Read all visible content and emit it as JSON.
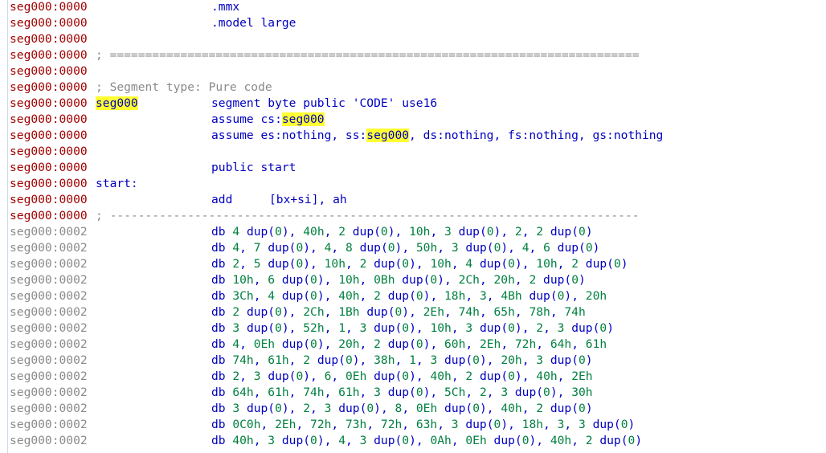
{
  "lines": [
    {
      "addr": "seg000:0000",
      "kind": "code",
      "instr": ".mmx"
    },
    {
      "addr": "seg000:0000",
      "kind": "code",
      "instr": ".model large"
    },
    {
      "addr": "seg000:0000",
      "kind": "code"
    },
    {
      "addr": "seg000:0000",
      "kind": "code",
      "comment": "; ==========================================================================="
    },
    {
      "addr": "seg000:0000",
      "kind": "code"
    },
    {
      "addr": "seg000:0000",
      "kind": "code",
      "comment": "; Segment type: Pure code"
    },
    {
      "addr": "seg000:0000",
      "kind": "code",
      "label_hl": "seg000",
      "instr": "segment byte public 'CODE' use16"
    },
    {
      "addr": "seg000:0000",
      "kind": "code",
      "instr_pre": "assume cs:",
      "instr_hl": "seg000"
    },
    {
      "addr": "seg000:0000",
      "kind": "code",
      "instr_pre": "assume es:nothing, ss:",
      "instr_hl": "seg000",
      "instr_post": ", ds:nothing, fs:nothing, gs:nothing"
    },
    {
      "addr": "seg000:0000",
      "kind": "code"
    },
    {
      "addr": "seg000:0000",
      "kind": "code",
      "instr": "public start"
    },
    {
      "addr": "seg000:0000",
      "kind": "code",
      "label": "start:"
    },
    {
      "addr": "seg000:0000",
      "kind": "code",
      "instr": "add",
      "operand": "[bx+si], ah"
    },
    {
      "addr": "seg000:0000",
      "kind": "code",
      "comment": "; ---------------------------------------------------------------------------"
    },
    {
      "addr": "seg000:0002",
      "kind": "data",
      "db": "db 4 dup(0), 40h, 2 dup(0), 10h, 3 dup(0), 2, 2 dup(0)"
    },
    {
      "addr": "seg000:0002",
      "kind": "data",
      "db": "db 4, 7 dup(0), 4, 8 dup(0), 50h, 3 dup(0), 4, 6 dup(0)"
    },
    {
      "addr": "seg000:0002",
      "kind": "data",
      "db": "db 2, 5 dup(0), 10h, 2 dup(0), 10h, 4 dup(0), 10h, 2 dup(0)"
    },
    {
      "addr": "seg000:0002",
      "kind": "data",
      "db": "db 10h, 6 dup(0), 10h, 0Bh dup(0), 2Ch, 20h, 2 dup(0)"
    },
    {
      "addr": "seg000:0002",
      "kind": "data",
      "db": "db 3Ch, 4 dup(0), 40h, 2 dup(0), 18h, 3, 4Bh dup(0), 20h"
    },
    {
      "addr": "seg000:0002",
      "kind": "data",
      "db": "db 2 dup(0), 2Ch, 1Bh dup(0), 2Eh, 74h, 65h, 78h, 74h"
    },
    {
      "addr": "seg000:0002",
      "kind": "data",
      "db": "db 3 dup(0), 52h, 1, 3 dup(0), 10h, 3 dup(0), 2, 3 dup(0)"
    },
    {
      "addr": "seg000:0002",
      "kind": "data",
      "db": "db 4, 0Eh dup(0), 20h, 2 dup(0), 60h, 2Eh, 72h, 64h, 61h"
    },
    {
      "addr": "seg000:0002",
      "kind": "data",
      "db": "db 74h, 61h, 2 dup(0), 38h, 1, 3 dup(0), 20h, 3 dup(0)"
    },
    {
      "addr": "seg000:0002",
      "kind": "data",
      "db": "db 2, 3 dup(0), 6, 0Eh dup(0), 40h, 2 dup(0), 40h, 2Eh"
    },
    {
      "addr": "seg000:0002",
      "kind": "data",
      "db": "db 64h, 61h, 74h, 61h, 3 dup(0), 5Ch, 2, 3 dup(0), 30h"
    },
    {
      "addr": "seg000:0002",
      "kind": "data",
      "db": "db 3 dup(0), 2, 3 dup(0), 8, 0Eh dup(0), 40h, 2 dup(0)"
    },
    {
      "addr": "seg000:0002",
      "kind": "data",
      "db": "db 0C0h, 2Eh, 72h, 73h, 72h, 63h, 3 dup(0), 18h, 3, 3 dup(0)"
    },
    {
      "addr": "seg000:0002",
      "kind": "data",
      "db": "db 40h, 3 dup(0), 4, 3 dup(0), 0Ah, 0Eh dup(0), 40h, 2 dup(0)"
    }
  ],
  "colors": {
    "code_address": "#a00000",
    "data_address": "#8a8a8a",
    "instruction": "#0000c0",
    "comment": "#8a8a8a",
    "number": "#008040",
    "highlight": "#ffff33"
  }
}
